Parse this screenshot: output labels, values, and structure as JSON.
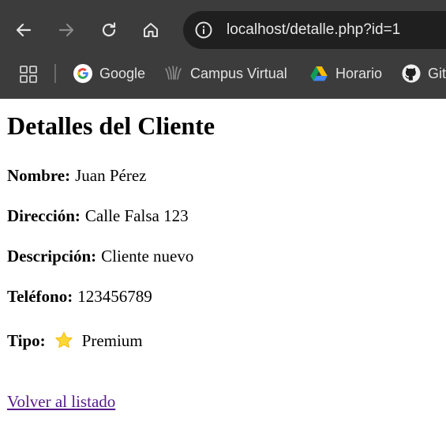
{
  "browser": {
    "url": "localhost/detalle.php?id=1",
    "bookmarks": [
      {
        "label": "Google",
        "icon": "google-icon"
      },
      {
        "label": "Campus Virtual",
        "icon": "campus-virtual-icon"
      },
      {
        "label": "Horario",
        "icon": "google-drive-icon"
      },
      {
        "label": "Git",
        "icon": "github-icon"
      }
    ]
  },
  "page": {
    "title": "Detalles del Cliente",
    "fields": [
      {
        "label": "Nombre:",
        "value": "Juan Pérez"
      },
      {
        "label": "Dirección:",
        "value": "Calle Falsa 123"
      },
      {
        "label": "Descripción:",
        "value": "Cliente nuevo"
      },
      {
        "label": "Teléfono:",
        "value": "123456789"
      },
      {
        "label": "Tipo:",
        "value": "Premium",
        "icon": "star-icon"
      }
    ],
    "back_link": "Volver al listado",
    "colors": {
      "link_visited": "#551a8b",
      "star": "#fdd835",
      "chrome_bg": "#3c3c3c"
    }
  }
}
